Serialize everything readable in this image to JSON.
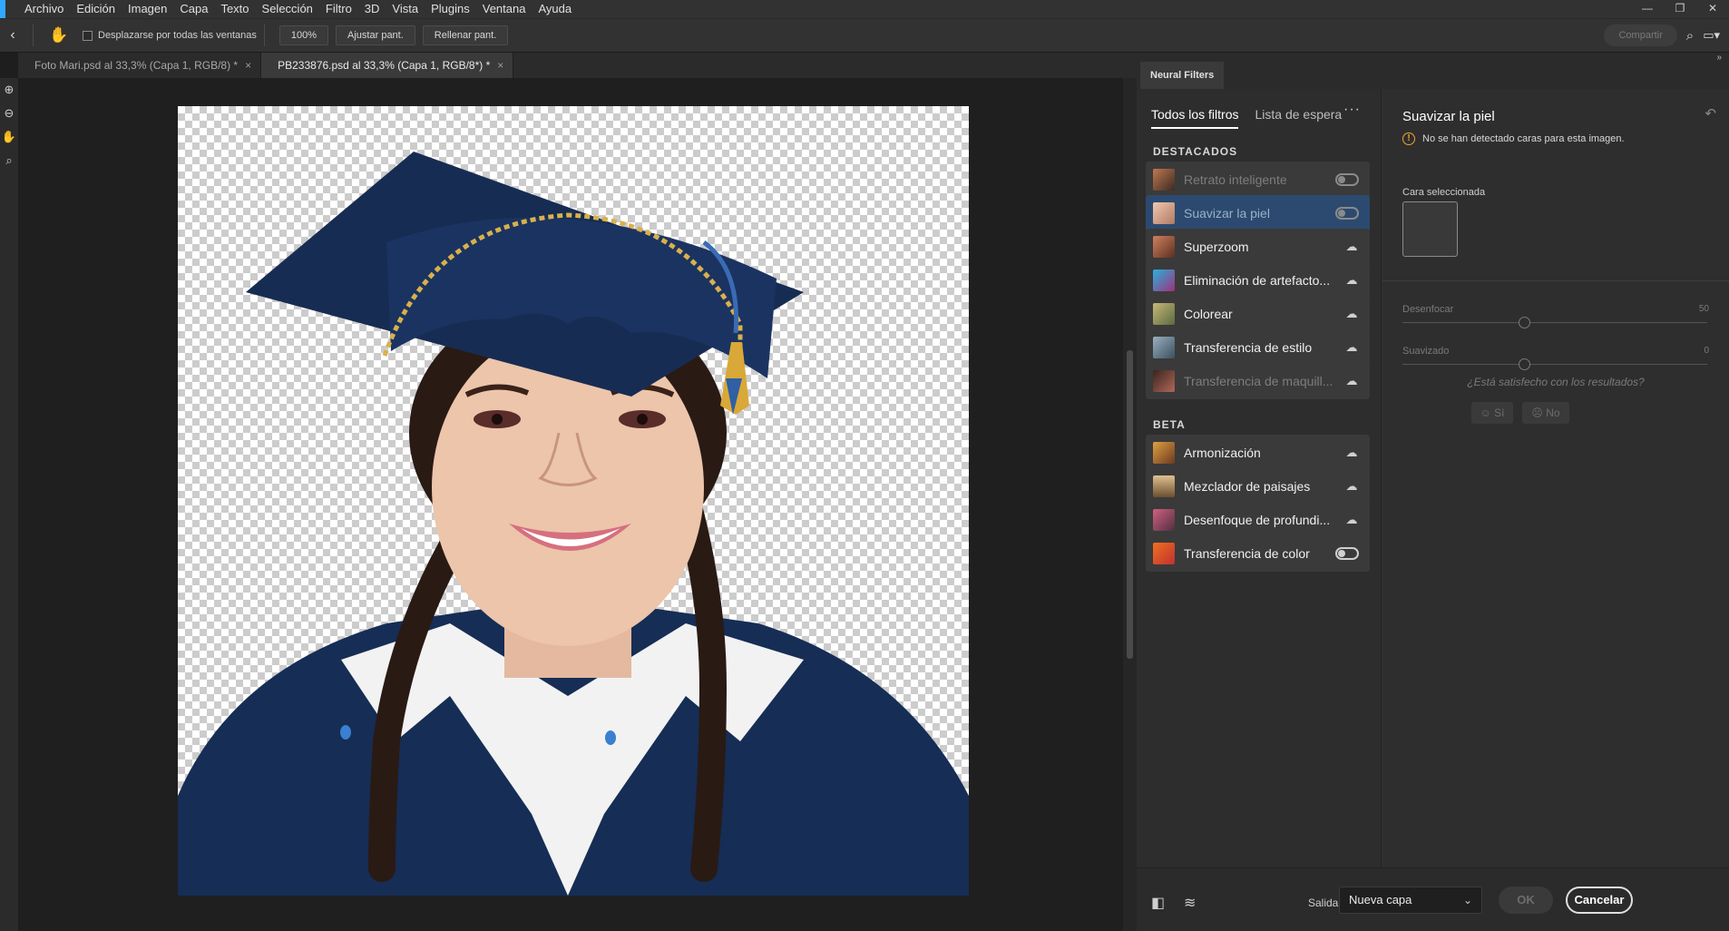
{
  "menubar": {
    "items": [
      "Archivo",
      "Edición",
      "Imagen",
      "Capa",
      "Texto",
      "Selección",
      "Filtro",
      "3D",
      "Vista",
      "Plugins",
      "Ventana",
      "Ayuda"
    ],
    "window_controls": [
      "—",
      "❐",
      "✕"
    ]
  },
  "options": {
    "scroll_all_label": "Desplazarse por todas las ventanas",
    "zoom_value": "100%",
    "fit_screen": "Ajustar pant.",
    "fill_screen": "Rellenar pant.",
    "share": "Compartir"
  },
  "tabs": [
    {
      "label": "Foto Mari.psd al 33,3% (Capa 1, RGB/8) *",
      "close": "×"
    },
    {
      "label": "PB233876.psd al 33,3% (Capa 1, RGB/8*) *",
      "close": "×"
    }
  ],
  "neural": {
    "panel_title": "Neural Filters",
    "tab_all": "Todos los filtros",
    "tab_waitlist": "Lista de espera",
    "more": "···",
    "section_featured": "DESTACADOS",
    "section_beta": "BETA",
    "featured": [
      {
        "label": "Retrato inteligente",
        "state": "toggle-off",
        "dim": true
      },
      {
        "label": "Suavizar la piel",
        "state": "toggle-off",
        "dim": true,
        "selected": true
      },
      {
        "label": "Superzoom",
        "state": "cloud"
      },
      {
        "label": "Eliminación de artefacto...",
        "state": "cloud"
      },
      {
        "label": "Colorear",
        "state": "cloud"
      },
      {
        "label": "Transferencia de estilo",
        "state": "cloud"
      },
      {
        "label": "Transferencia de maquill...",
        "state": "cloud",
        "dim": true
      }
    ],
    "beta": [
      {
        "label": "Armonización",
        "state": "cloud"
      },
      {
        "label": "Mezclador de paisajes",
        "state": "cloud"
      },
      {
        "label": "Desenfoque de profundi...",
        "state": "cloud"
      },
      {
        "label": "Transferencia de color",
        "state": "toggle-on"
      }
    ],
    "settings": {
      "title": "Suavizar la piel",
      "warning": "No se han detectado caras para esta imagen.",
      "face_label": "Cara seleccionada",
      "blur_label": "Desenfocar",
      "blur_value": "50",
      "smooth_label": "Suavizado",
      "smooth_value": "0",
      "satisfied": "¿Está satisfecho con los resultados?",
      "yes": "Sí",
      "no": "No"
    },
    "footer": {
      "output_label": "Salida",
      "output_value": "Nueva capa",
      "ok": "OK",
      "cancel": "Cancelar"
    }
  },
  "colors": {
    "accent": "#31a8ff",
    "selected_row": "#2c4a6f",
    "gown": "#162d55"
  },
  "icons": [
    "photoshop-logo",
    "back-arrow-icon",
    "hand-icon",
    "zoom-in-icon",
    "zoom-out-icon",
    "hand-tool-icon",
    "zoom-tool-icon",
    "warning-icon",
    "reset-icon",
    "cloud-download-icon",
    "compare-icon",
    "layers-icon",
    "search-icon",
    "workspace-icon"
  ]
}
